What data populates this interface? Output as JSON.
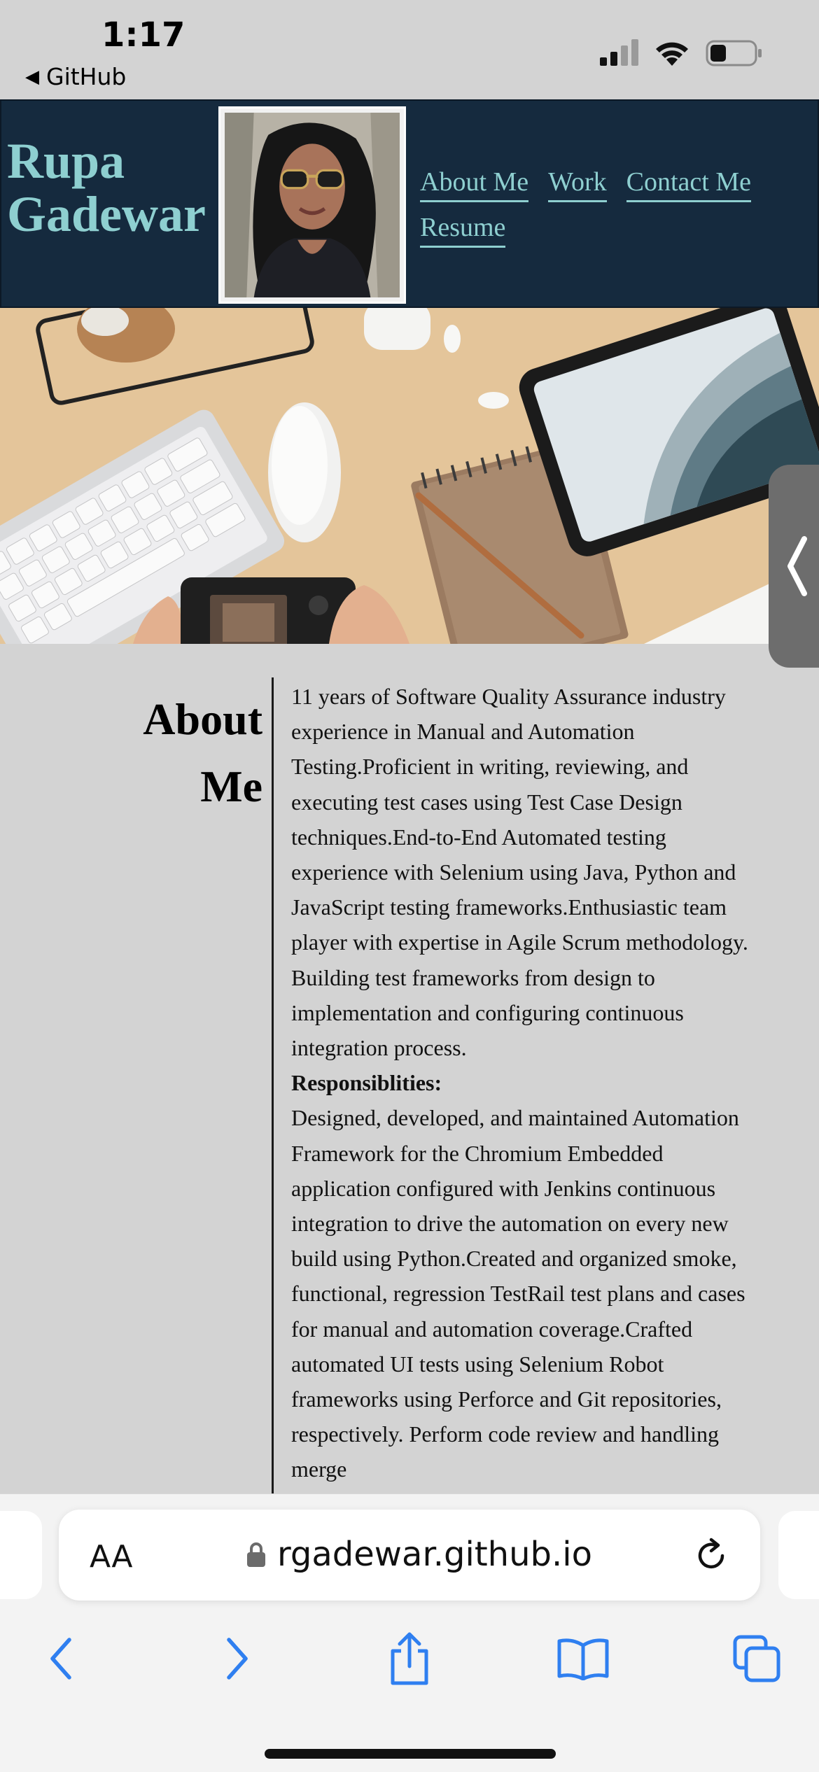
{
  "status_bar": {
    "time": "1:17",
    "back_label": "GitHub",
    "back_icon": "back-triangle-icon",
    "icons": [
      "cellular-signal-icon",
      "wifi-icon",
      "battery-icon"
    ]
  },
  "header": {
    "title_line1": "Rupa",
    "title_line2": "Gadewar",
    "photo": "profile-photo",
    "nav": [
      "About Me",
      "Work",
      "Contact Me",
      "Resume"
    ],
    "colors": {
      "background": "#152a3e",
      "accent": "#8ecfd0"
    }
  },
  "hero": {
    "image": "workspace-desk-photo",
    "side_tab_icon": "chevron-left-icon"
  },
  "about": {
    "heading_line1": "About",
    "heading_line2": "Me",
    "summary": "11 years of Software Quality Assurance industry experience in Manual and Automation Testing.Proficient in writing, reviewing, and executing test cases using Test Case Design techniques.End-to-End Automated testing experience with Selenium using Java, Python and JavaScript testing frameworks.Enthusiastic team player with expertise in Agile Scrum methodology. Building test frameworks from design to implementation and configuring continuous integration process.",
    "responsibilities_title": "Responsiblities:",
    "responsibilities": "Designed, developed, and maintained Automation Framework for the Chromium Embedded application configured with Jenkins continuous integration to drive the automation on every new build using Python.Created and organized smoke, functional, regression TestRail test plans and cases for manual and automation coverage.Crafted automated UI tests using Selenium Robot frameworks using Perforce and Git repositories, respectively. Perform code review and handling merge"
  },
  "browser": {
    "text_size_button": "AA",
    "url": "rgadewar.github.io",
    "lock_icon": "lock-icon",
    "reload_icon": "reload-icon",
    "toolbar_icons": [
      "back-arrow-icon",
      "forward-arrow-icon",
      "share-icon",
      "bookmarks-icon",
      "tabs-icon"
    ],
    "accent_color": "#2f7ff0"
  }
}
